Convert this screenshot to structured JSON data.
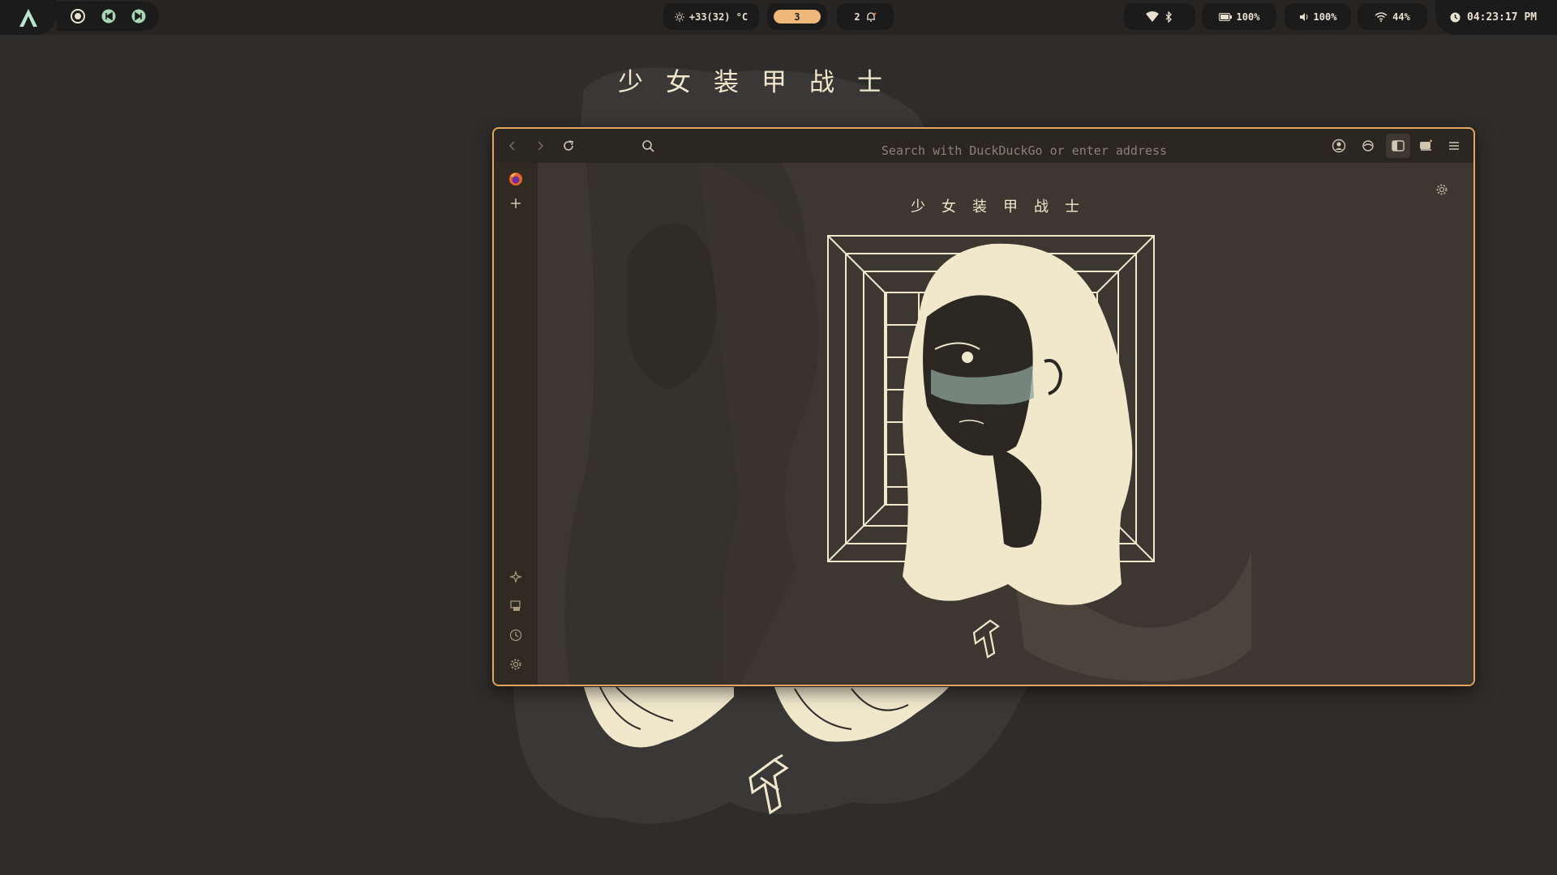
{
  "topbar": {
    "workspace": "3",
    "weather": "+33(32) °C",
    "notifications": "2",
    "battery": "100%",
    "volume": "100%",
    "wifi": "44%",
    "clock": "04:23:17 PM"
  },
  "wallpaper": {
    "title": "少女装甲战士"
  },
  "browser": {
    "search_placeholder": "Search with DuckDuckGo or enter address",
    "content_title": "少女装甲战士"
  },
  "colors": {
    "accent": "#e5a55c",
    "workspace_badge": "#f0b878",
    "cream": "#f1e8cc"
  }
}
